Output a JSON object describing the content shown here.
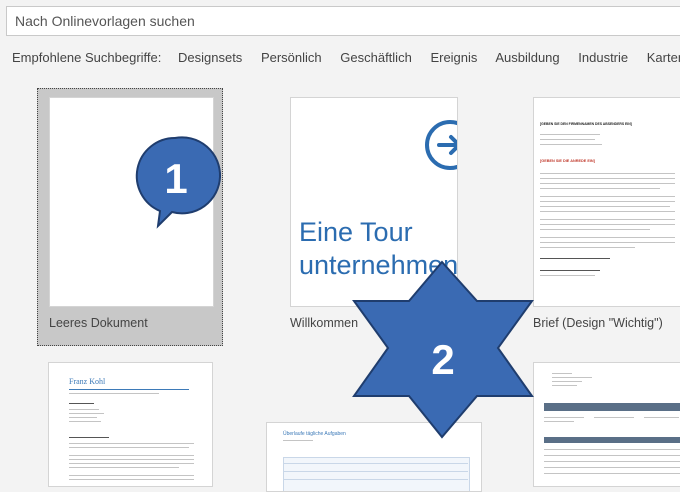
{
  "search": {
    "placeholder": "Nach Onlinevorlagen suchen"
  },
  "suggested": {
    "label": "Empfohlene Suchbegriffe:",
    "terms": [
      "Designsets",
      "Persönlich",
      "Geschäftlich",
      "Ereignis",
      "Ausbildung",
      "Industrie",
      "Karten"
    ]
  },
  "templates": [
    {
      "caption": "Leeres Dokument"
    },
    {
      "caption": "Willkommen",
      "title_line1": "Eine Tour",
      "title_line2": "unternehmen"
    },
    {
      "caption": "Brief (Design \"Wichtig\")",
      "heading": "[GEBEN SIE DEN FIRMENNAMEN DES ABSENDERS EIN]",
      "red_heading": "[GEBEN SIE DIE ANREDE EIN]"
    },
    {
      "name": "Franz Kohl"
    },
    {
      "title": "Überlaufe tägliche Aufgaben"
    },
    {}
  ],
  "annotations": {
    "callout_1": "1",
    "callout_2": "2"
  },
  "colors": {
    "accent": "#2b579a",
    "badge": "#3a6ab3",
    "badge_border": "#1f3d6e",
    "tour_blue": "#2b6cb0"
  }
}
